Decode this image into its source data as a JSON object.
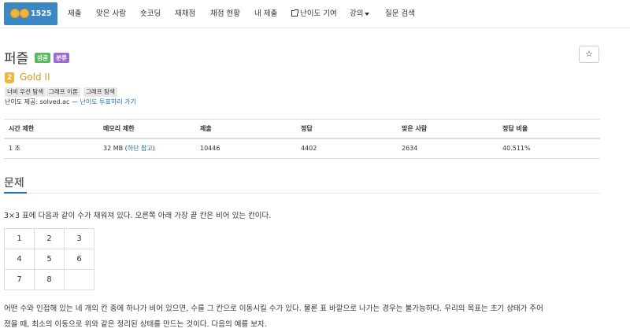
{
  "nav": {
    "active_label": "1525번",
    "items": [
      "제출",
      "맞은 사람",
      "숏코딩",
      "재채점",
      "채점 현황",
      "내 제출",
      "난이도 기여",
      "강의",
      "질문 검색"
    ]
  },
  "problem": {
    "title": "퍼즐",
    "labels": [
      "성공",
      "분류"
    ],
    "star": "☆",
    "tier_number": "2",
    "tier_name": "Gold II",
    "tags": [
      "너비 우선 탐색",
      "그래프 이론",
      "그래프 탐색"
    ],
    "difficulty_prefix": "난이도 제공: solved.ac — ",
    "difficulty_link": "난이도 투표하러 가기"
  },
  "stats": {
    "headers": [
      "시간 제한",
      "메모리 제한",
      "제출",
      "정답",
      "맞은 사람",
      "정답 비율"
    ],
    "time_limit": "1 초",
    "memory_limit": "32 MB",
    "memory_note_open": " (",
    "memory_note_link": "하단 참고",
    "memory_note_close": ")",
    "submissions": "10446",
    "accepted": "4402",
    "solvers": "2634",
    "ratio": "40.511%"
  },
  "section": {
    "title": "문제",
    "intro": "3×3 표에 다음과 같이 수가 채워져 있다. 오른쪽 아래 가장 끝 칸은 비어 있는 칸이다.",
    "grid": [
      [
        "1",
        "2",
        "3"
      ],
      [
        "4",
        "5",
        "6"
      ],
      [
        "7",
        "8",
        ""
      ]
    ],
    "body_line1": "어떤 수와 인접해 있는 네 개의 칸 중에 하나가 비어 있으면, 수를 그 칸으로 이동시킬 수가 있다. 물론 표 바깥으로 나가는 경우는 불가능하다. 우리의 목표는 초기 상태가 주어",
    "body_line2": "졌을 때, 최소의 이동으로 위와 같은 정리된 상태를 만드는 것이다. 다음의 예를 보자."
  },
  "colors": {
    "active_nav_bg": "#3b88c3",
    "success_label": "#5cb85c",
    "tag_label": "#9c6ad8",
    "gold": "#d49a27",
    "link": "#1f6fb5"
  }
}
